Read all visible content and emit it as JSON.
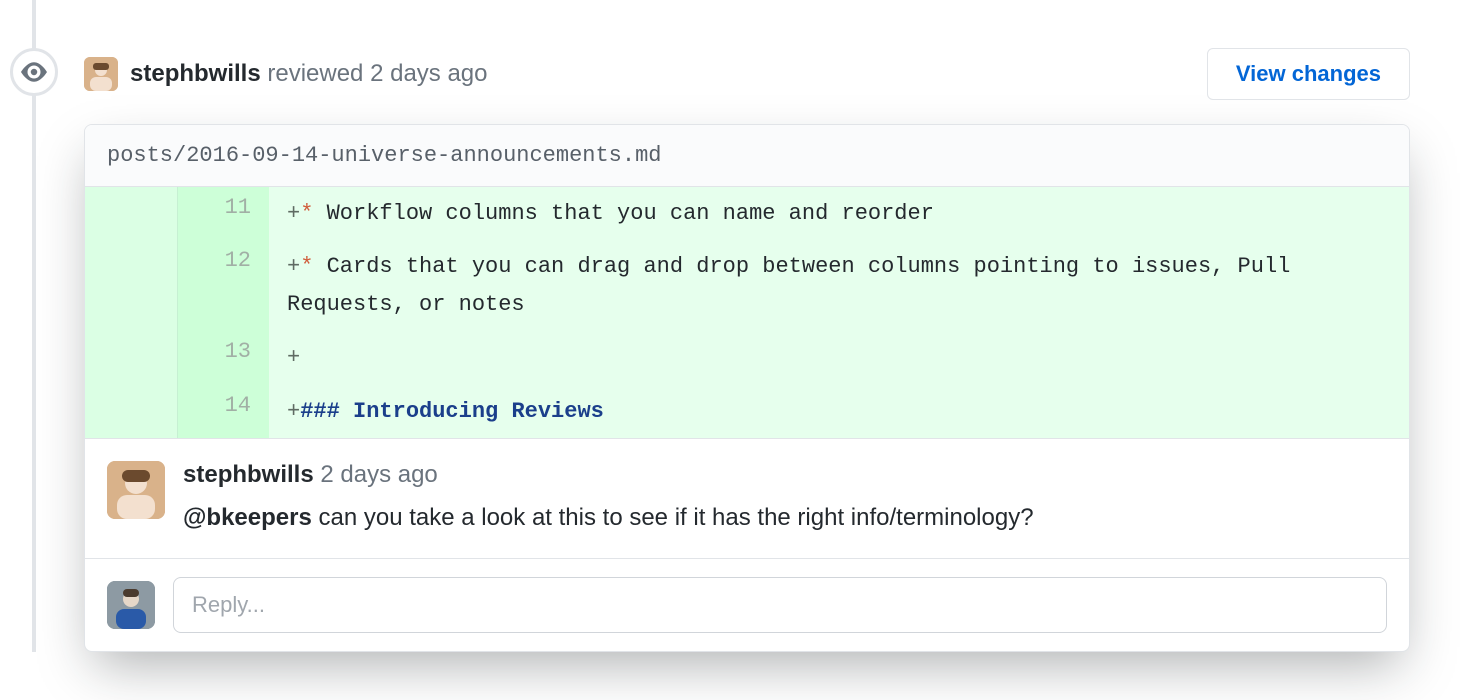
{
  "review_header": {
    "username": "stephbwills",
    "action_text": "reviewed",
    "timestamp": "2 days ago",
    "view_changes_label": "View changes"
  },
  "file": {
    "path": "posts/2016-09-14-universe-announcements.md"
  },
  "diff": {
    "lines": [
      {
        "new_lineno": "11",
        "sigil": "+",
        "bullet": "*",
        "text": " Workflow columns that you can name and reorder"
      },
      {
        "new_lineno": "12",
        "sigil": "+",
        "bullet": "*",
        "text": " Cards that you can drag and drop between columns pointing to issues, Pull Requests, or notes"
      },
      {
        "new_lineno": "13",
        "sigil": "+",
        "bullet": "",
        "text": ""
      },
      {
        "new_lineno": "14",
        "sigil": "+",
        "bullet": "",
        "heading": "### Introducing Reviews"
      }
    ]
  },
  "comment": {
    "author": "stephbwills",
    "timestamp": "2 days ago",
    "mention": "@bkeepers",
    "body_rest": " can you take a look at this to see if it has the right info/terminology?"
  },
  "reply": {
    "placeholder": "Reply..."
  },
  "icons": {
    "timeline_badge": "eye-icon"
  },
  "colors": {
    "link": "#0366d6",
    "diff_add_bg": "#e6ffed",
    "diff_gutter_bg": "#cdffd8",
    "border": "#e1e4e8",
    "muted": "#6a737d"
  }
}
